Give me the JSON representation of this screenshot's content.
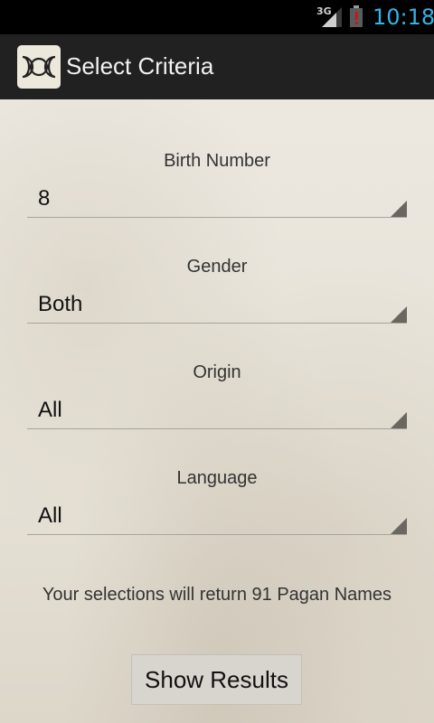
{
  "status_bar": {
    "network": "3G",
    "time": "10:18",
    "colors": {
      "time": "#33b5e5",
      "battery_alert": "#d01010"
    },
    "icons": [
      "signal-icon",
      "battery-alert-icon"
    ]
  },
  "action_bar": {
    "title": "Select Criteria",
    "icon": "triple-moon-icon"
  },
  "form": {
    "birth_number": {
      "label": "Birth Number",
      "value": "8"
    },
    "gender": {
      "label": "Gender",
      "value": "Both"
    },
    "origin": {
      "label": "Origin",
      "value": "All"
    },
    "language": {
      "label": "Language",
      "value": "All"
    }
  },
  "result_text": "Your selections will return 91 Pagan Names",
  "show_button_label": "Show Results"
}
